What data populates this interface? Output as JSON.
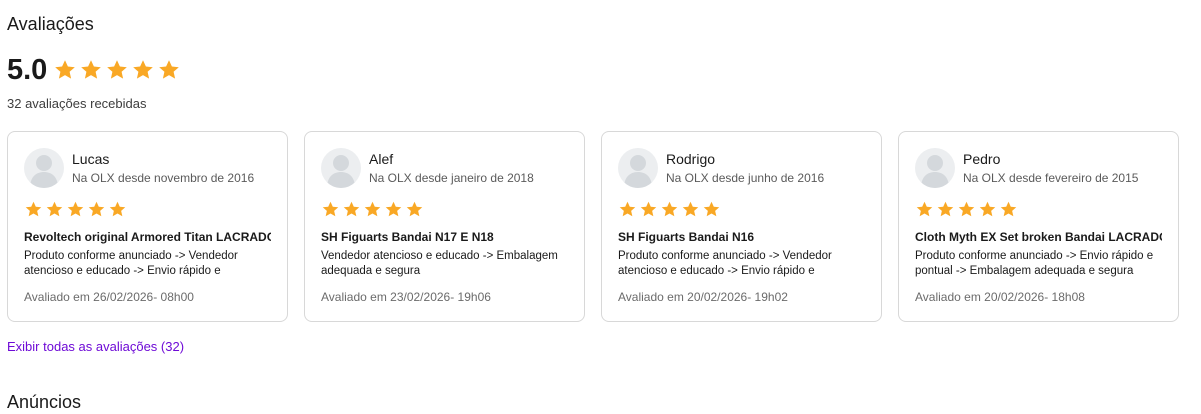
{
  "section": {
    "title": "Avaliações",
    "rating_value": "5.0",
    "rating_stars": 5,
    "rating_count_text": "32 avaliações recebidas",
    "show_all_link": "Exibir todas as avaliações (32)",
    "next_section_title": "Anúncios"
  },
  "colors": {
    "star": "#f9a825",
    "link": "#6e0ad6"
  },
  "reviews": [
    {
      "name": "Lucas",
      "since": "Na OLX desde novembro de 2016",
      "stars": 5,
      "title": "Revoltech original Armored Titan LACRADO",
      "text": "Produto conforme anunciado -> Vendedor atencioso e educado -> Envio rápido e",
      "date": "Avaliado em 26/02/2026- 08h00"
    },
    {
      "name": "Alef",
      "since": "Na OLX desde janeiro de 2018",
      "stars": 5,
      "title": "SH Figuarts Bandai N17 E N18",
      "text": "Vendedor atencioso e educado -> Embalagem adequada e segura",
      "date": "Avaliado em 23/02/2026- 19h06"
    },
    {
      "name": "Rodrigo",
      "since": "Na OLX desde junho de 2016",
      "stars": 5,
      "title": "SH Figuarts Bandai N16",
      "text": "Produto conforme anunciado -> Vendedor atencioso e educado -> Envio rápido e",
      "date": "Avaliado em 20/02/2026- 19h02"
    },
    {
      "name": "Pedro",
      "since": "Na OLX desde fevereiro de 2015",
      "stars": 5,
      "title": "Cloth Myth EX Set broken Bandai LACRADO",
      "text": "Produto conforme anunciado -> Envio rápido e pontual -> Embalagem adequada e segura",
      "date": "Avaliado em 20/02/2026- 18h08"
    }
  ]
}
